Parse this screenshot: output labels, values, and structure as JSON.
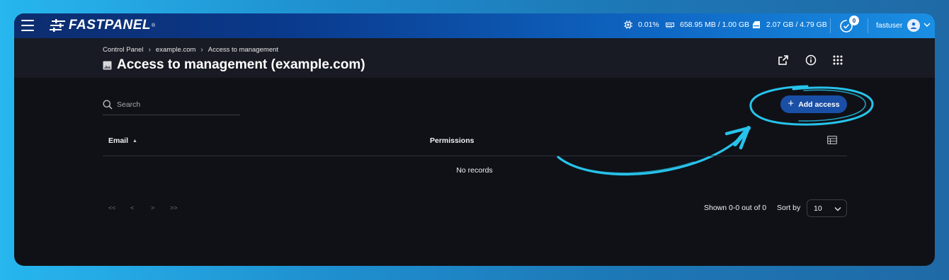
{
  "topbar": {
    "brand": "FASTPANEL",
    "brand_mark": "®",
    "cpu": "0.01%",
    "memory": "658.95 MB / 1.00 GB",
    "disk": "2.07 GB / 4.79 GB",
    "notifications_count": "0",
    "username": "fastuser",
    "icons": [
      "menu-icon",
      "cpu-icon",
      "memory-icon",
      "disk-icon",
      "tasks-icon",
      "user-icon",
      "chevron-down-icon"
    ]
  },
  "breadcrumb": [
    "Control Panel",
    "example.com",
    "Access to management"
  ],
  "page": {
    "title": "Access to management (example.com)",
    "header_icons": [
      "external-link-icon",
      "info-icon",
      "apps-grid-icon"
    ]
  },
  "search": {
    "placeholder": "Search"
  },
  "add_button": {
    "label": "Add access"
  },
  "table": {
    "columns": [
      "Email",
      "Permissions"
    ],
    "sorted_column": "Email",
    "sort_direction": "ascending",
    "empty_text": "No records"
  },
  "pagination": {
    "first": "<<",
    "prev": "<",
    "next": ">",
    "last": ">>",
    "shown": "Shown 0-0 out of 0",
    "sort_by_label": "Sort by",
    "page_size": "10"
  },
  "colors": {
    "accent": "#1a4fa6",
    "annotation": "#27c3ea",
    "background": "#0f1117",
    "header": "#181b23"
  }
}
